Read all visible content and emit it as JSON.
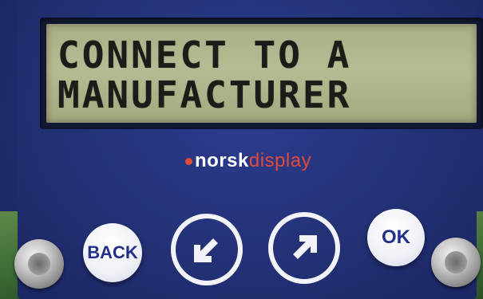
{
  "lcd": {
    "line1": "CONNECT TO A",
    "line2": "MANUFACTURER"
  },
  "brand": {
    "norsk": "norsk",
    "display": "display",
    "accent_color": "#e04a3a"
  },
  "buttons": {
    "back_label": "BACK",
    "down_left_icon": "arrow-down-left-icon",
    "up_right_icon": "arrow-up-right-icon",
    "ok_label": "OK"
  },
  "colors": {
    "panel": "#243379",
    "lcd_background": "#b7bb93",
    "lcd_text": "#1c1c18",
    "button_face": "#ffffff",
    "button_text": "#23308a"
  }
}
